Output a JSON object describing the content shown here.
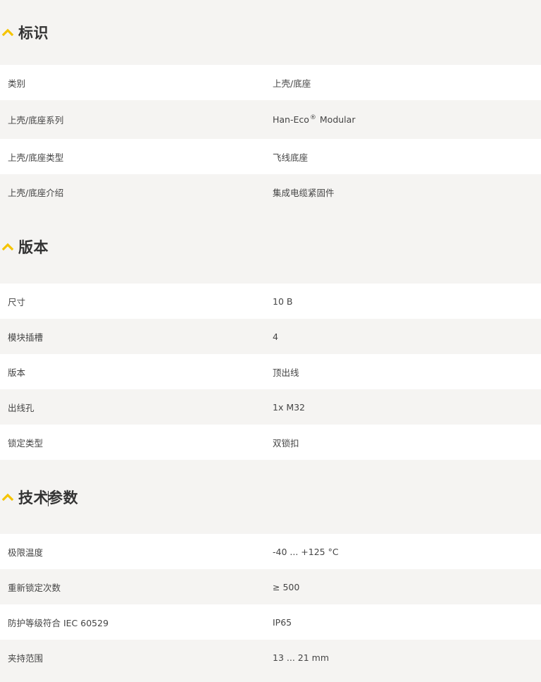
{
  "colors": {
    "accent": "#f5c400",
    "background": "#f5f4f2",
    "row_white": "#ffffff",
    "text": "#333333"
  },
  "sections": [
    {
      "title": "标识",
      "icon": "chevron-up-icon",
      "rows": [
        {
          "label": "类别",
          "value": "上壳/底座"
        },
        {
          "label": "上壳/底座系列",
          "value_main": "Han-Eco",
          "value_sup": "®",
          "value_tail": " Modular"
        },
        {
          "label": "上壳/底座类型",
          "value": "飞线底座"
        },
        {
          "label": "上壳/底座介绍",
          "value": "集成电缆紧固件"
        }
      ]
    },
    {
      "title": "版本",
      "icon": "chevron-up-icon",
      "rows": [
        {
          "label": "尺寸",
          "value": "10 B"
        },
        {
          "label": "模块插槽",
          "value": "4"
        },
        {
          "label": "版本",
          "value": "顶出线"
        },
        {
          "label": "出线孔",
          "value": "1x M32"
        },
        {
          "label": "锁定类型",
          "value": "双锁扣"
        }
      ]
    },
    {
      "title_part1": "技术",
      "title_part2": "参数",
      "icon": "chevron-up-icon",
      "rows": [
        {
          "label": "极限温度",
          "value": "-40 ... +125 °C"
        },
        {
          "label": "重新锁定次数",
          "value": "≥ 500"
        },
        {
          "label": "防护等级符合 IEC 60529",
          "value": "IP65"
        },
        {
          "label": "夹持范围",
          "value": "13 ... 21 mm"
        }
      ]
    }
  ]
}
